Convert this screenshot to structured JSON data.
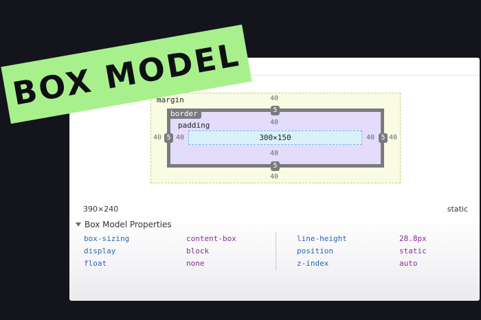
{
  "banner": {
    "text": "BOX MODEL"
  },
  "box_model": {
    "margin": {
      "label": "margin",
      "top": "40",
      "right": "40",
      "bottom": "40",
      "left": "40"
    },
    "border": {
      "label": "border",
      "top": "5",
      "right": "5",
      "bottom": "5",
      "left": "5"
    },
    "padding": {
      "label": "padding",
      "top": "40",
      "right": "40",
      "bottom": "40",
      "left": "40"
    },
    "content": {
      "size": "300×150"
    }
  },
  "info": {
    "dimensions": "390×240",
    "position": "static"
  },
  "properties_section": {
    "title": "Box Model Properties",
    "left": [
      {
        "name": "box-sizing",
        "value": "content-box"
      },
      {
        "name": "display",
        "value": "block"
      },
      {
        "name": "float",
        "value": "none"
      }
    ],
    "right": [
      {
        "name": "line-height",
        "value": "28.8px"
      },
      {
        "name": "position",
        "value": "static"
      },
      {
        "name": "z-index",
        "value": "auto"
      }
    ]
  },
  "colors": {
    "background": "#14141c",
    "banner": "#a8f08c",
    "margin_fill": "#f9fce2",
    "border_fill": "#7b7b7e",
    "padding_fill": "#e3dcfb",
    "content_fill": "#d8f1fb",
    "property_name": "#2a63b8",
    "property_value": "#8a2a9a"
  }
}
